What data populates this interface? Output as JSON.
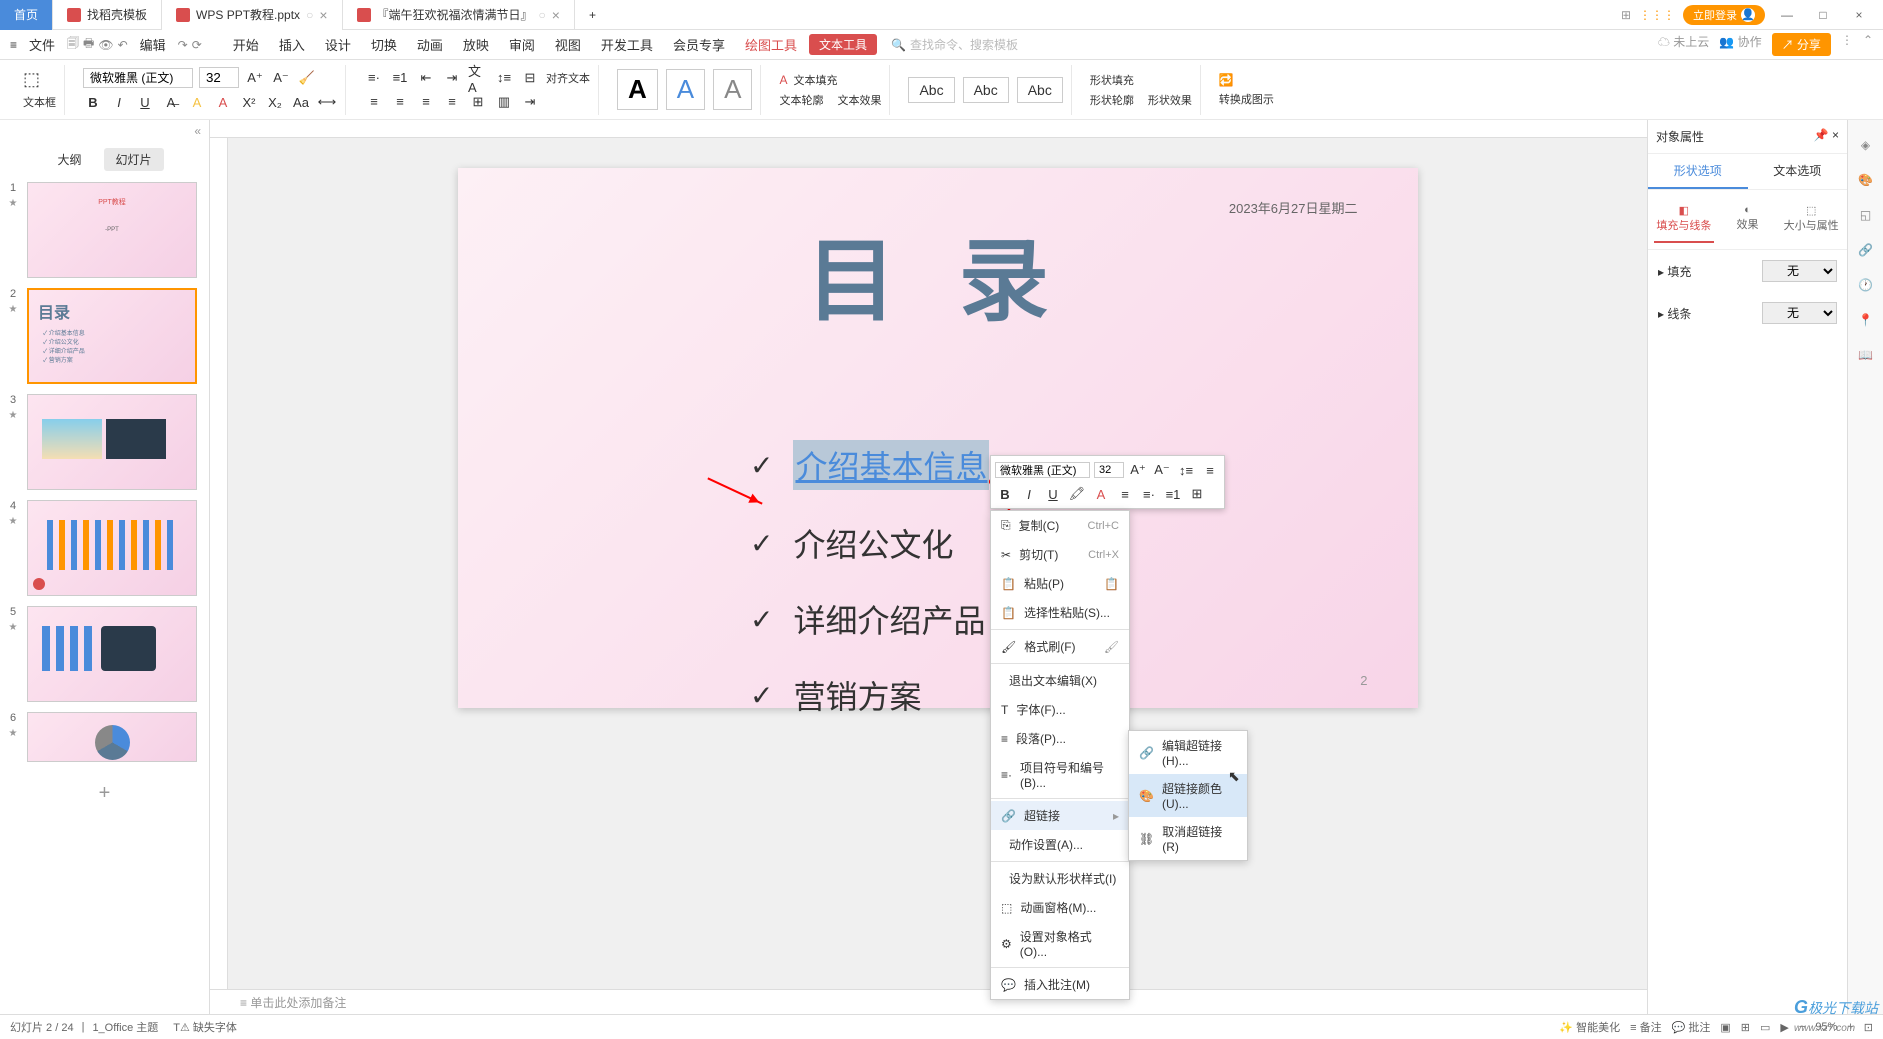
{
  "titlebar": {
    "home": "首页",
    "tab1": "找稻壳模板",
    "tab2": "WPS PPT教程.pptx",
    "tab3": "『端午狂欢祝福浓情满节日』",
    "login": "立即登录"
  },
  "menubar": {
    "file": "文件",
    "edit": "编辑",
    "items": [
      "开始",
      "插入",
      "设计",
      "切换",
      "动画",
      "放映",
      "审阅",
      "视图",
      "开发工具",
      "会员专享"
    ],
    "drawing": "绘图工具",
    "text_tool": "文本工具",
    "search_cmd": "查找命令、搜索模板",
    "not_uploaded": "未上云",
    "collab": "协作",
    "share": "分享"
  },
  "toolbar": {
    "textbox": "文本框",
    "font_name": "微软雅黑 (正文)",
    "font_size": "32",
    "align_text": "对齐文本",
    "text_fill": "文本填充",
    "text_outline": "文本轮廓",
    "text_effect": "文本效果",
    "abc1": "Abc",
    "abc2": "Abc",
    "abc3": "Abc",
    "shape_fill": "形状填充",
    "shape_outline": "形状轮廓",
    "shape_effect": "形状效果",
    "convert": "转换成图示"
  },
  "slide_panel": {
    "outline": "大纲",
    "slides": "幻灯片",
    "nums": [
      "1",
      "2",
      "3",
      "4",
      "5",
      "6"
    ]
  },
  "canvas": {
    "title": "目 录",
    "date": "2023年6月27日星期二",
    "page": "2",
    "items": [
      "介绍基本信息",
      "介绍公文化",
      "详细介绍产品",
      "营销方案"
    ]
  },
  "mini_toolbar": {
    "font": "微软雅黑 (正文)",
    "size": "32"
  },
  "context_menu": {
    "copy": "复制(C)",
    "copy_key": "Ctrl+C",
    "cut": "剪切(T)",
    "cut_key": "Ctrl+X",
    "paste": "粘贴(P)",
    "paste_special": "选择性粘贴(S)...",
    "format_painter": "格式刷(F)",
    "exit_text": "退出文本编辑(X)",
    "font": "字体(F)...",
    "paragraph": "段落(P)...",
    "bullets": "项目符号和编号(B)...",
    "hyperlink": "超链接",
    "action": "动作设置(A)...",
    "default_shape": "设为默认形状样式(I)",
    "anim_pane": "动画窗格(M)...",
    "format_obj": "设置对象格式(O)...",
    "insert_comment": "插入批注(M)"
  },
  "submenu": {
    "edit_link": "编辑超链接(H)...",
    "link_color": "超链接颜色(U)...",
    "remove_link": "取消超链接(R)"
  },
  "notes": "单击此处添加备注",
  "prop_panel": {
    "title": "对象属性",
    "shape_opts": "形状选项",
    "text_opts": "文本选项",
    "fill_line": "填充与线条",
    "effect": "效果",
    "size_prop": "大小与属性",
    "fill": "填充",
    "fill_val": "无",
    "line": "线条",
    "line_val": "无"
  },
  "statusbar": {
    "slide_info": "幻灯片 2 / 24",
    "theme": "1_Office 主题",
    "missing_font": "缺失字体",
    "smart_beauty": "智能美化",
    "notes": "备注",
    "comments": "批注",
    "zoom": "95%"
  },
  "watermark": {
    "brand": "极光下载站",
    "url": "www.xz7.com"
  }
}
